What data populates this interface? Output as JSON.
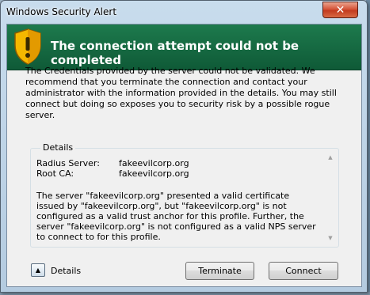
{
  "window": {
    "title": "Windows Security Alert",
    "close_glyph": "✕"
  },
  "banner": {
    "icon": "warning-shield-icon",
    "title": "The connection attempt could not be completed"
  },
  "description": "The Credentials provided by the server could not be validated. We recommend that you terminate the connection and contact your administrator with the information provided in the details. You may still connect but doing so exposes you to security risk by a possible rogue server.",
  "details": {
    "caption": "Details",
    "rows": [
      {
        "label": "Radius Server:",
        "value": "fakeevilcorp.org"
      },
      {
        "label": "Root CA:",
        "value": "fakeevilcorp.org"
      }
    ],
    "paragraph": "The server \"fakeevilcorp.org\" presented a valid certificate issued by \"fakeevilcorp.org\", but \"fakeevilcorp.org\" is not configured as a valid trust anchor for this profile. Further, the server \"fakeevilcorp.org\" is not configured as a valid NPS server to connect to for this profile."
  },
  "footer": {
    "toggle_glyph": "▲",
    "toggle_label": "Details",
    "terminate_label": "Terminate",
    "connect_label": "Connect"
  },
  "colors": {
    "banner": "#0f5a37",
    "close_button": "#c23b1f"
  }
}
